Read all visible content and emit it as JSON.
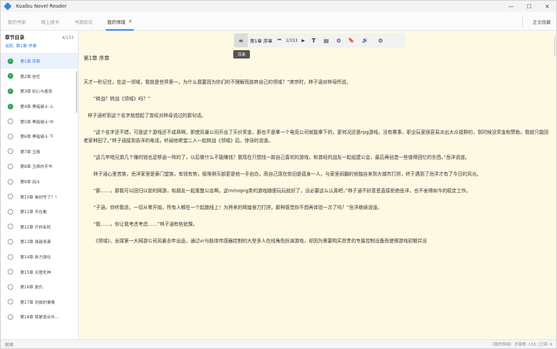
{
  "app": {
    "title": "Kuaibu Novel Reader"
  },
  "window_controls": {
    "minimize": "—",
    "maximize": "☐",
    "close": "✕"
  },
  "tabs": [
    {
      "label": "我的书架"
    },
    {
      "label": "网上搜书"
    },
    {
      "label": "书源验证"
    },
    {
      "label": "我的领域",
      "close": "✕"
    }
  ],
  "tab_right": {
    "label": "正文隐藏"
  },
  "sidebar": {
    "title": "章节目录",
    "count": "4/153",
    "current": "当前: 第1章 序章",
    "chapters": [
      {
        "label": "第1章 序章",
        "done": true
      },
      {
        "label": "第2章 信任",
        "done": true
      },
      {
        "label": "第3章 初心与善良",
        "done": true
      },
      {
        "label": "第4章 黑暗骑士·上",
        "done": true
      },
      {
        "label": "第5章 黑暗骑士·中",
        "done": false
      },
      {
        "label": "第6章 黑暗骑士·下",
        "done": false
      },
      {
        "label": "第7章 玉佩",
        "done": false
      },
      {
        "label": "第8章 玉佩的天书",
        "done": false
      },
      {
        "label": "第9章 战斗",
        "done": false
      },
      {
        "label": "第10章 被封号了？！",
        "done": false
      },
      {
        "label": "第11章 天在看",
        "done": false
      },
      {
        "label": "第12章 开的有机",
        "done": false
      },
      {
        "label": "第13章 强敌来袭",
        "done": false
      },
      {
        "label": "第14章 新力强化",
        "done": false
      },
      {
        "label": "第15章 无冒死神",
        "done": false
      },
      {
        "label": "第16章 复仇",
        "done": false
      },
      {
        "label": "第17章 剑拔的事情",
        "done": false
      },
      {
        "label": "第18章 我是混合年...",
        "done": false
      }
    ]
  },
  "toolbar": {
    "menu_icon": "≡",
    "chapter": "第1章 序章",
    "prev_icon": "⏮",
    "prev_page_icon": "◀",
    "page": "1/153",
    "next_page_icon": "▶",
    "text_icon": "T",
    "bookmark_list_icon": "▤",
    "settings_icon": "⚙",
    "bookmark_icon": "🔖",
    "audio_icon": "🔊",
    "gear_icon": "⚙",
    "tooltip": "目录"
  },
  "content": {
    "chapter_title": "第1章 序章",
    "paragraphs": [
      "天才一秒记住，在这一领域，我就是世界第一，为什么我要因为你们的不理解而放弃自己的领域？”席宗时，林子涵对林母所说。",
      "“转战？转战《领域》吗？”",
      "林子涵听到这个名字就想起了曾经对林母说过的那句话。",
      "“这个名字还不错，可是这个游戏还不成熟啊，即使风暴公司开出了天价奖金，那也不是拿一个电竞公司就能拿下的，更何况还是rpg游戏，没有赛事，职业玩家很容易淡出大众视野的，到时候没奖金和赞助，我就只能回老家种田了。”林子涵接到告洋的电话，听闻他希望二人一起转战《领域》后，惊讶的说道。",
      "“这几年咱兄弟几个赚的钱也足够逍一阵的了，以后做什么不能赚钱？我现在只想找一款自己喜欢的游戏，和曾经的战友一起组建公会，最后再创造一些值得回忆的东西。”岳洋说道。",
      "林子涵心里苦笑，岳洋家里是豪门望族，有钱有势，极限俱乐部更是他一手创办，而自己现在依旧是孤身一人，与家里闹翻的他独自来到大城市打拼，终于遇到了岳洋才有了今日的风光。",
      "“那……，那我可以回归以前的网游，和朋友一起重整公会啊，这mmoprg类的游戏随便玩玩就好了，没必要这么认真吧，”林子涵不好意思直接拒绝岳洋，也不舍得如今的稳定工作。",
      "“子涵，你听我说，一切从零开始，所有人都在一个起跑线上！为将来的辉煌奋力打拼，那种感觉你不想再体验一次了吗？”岳洋继续说道。",
      "“我……，你让我考虑考虑……”林子涵有些犹豫。",
      "《领域》，全球第一大网游公司风暴去年出品，通过vr与肢体传感器控制的大型多人在线角色扮演游戏，却因为需要购买昂贵的专属控制设备而使得游戏初期并没"
    ]
  },
  "status": {
    "left": "就绪",
    "right": "《我的领域》 总章数: 153 | 已读: 4"
  }
}
